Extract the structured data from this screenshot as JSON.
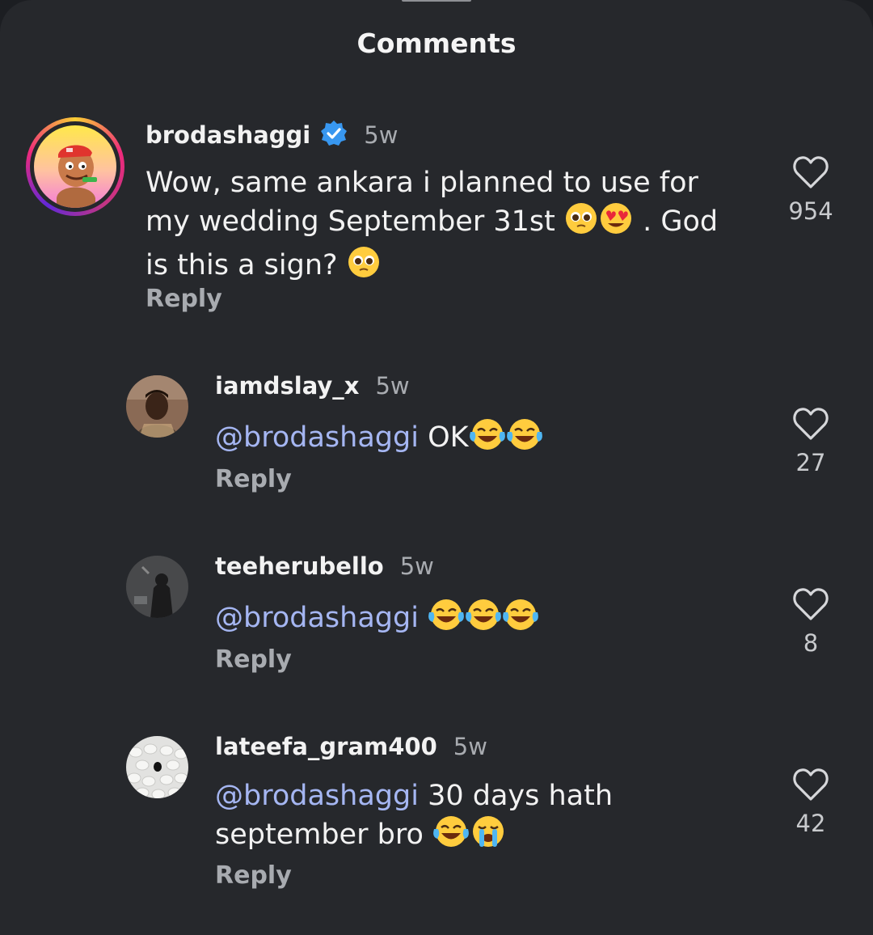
{
  "sheet": {
    "title": "Comments"
  },
  "comments": [
    {
      "username": "brodashaggi",
      "verified": true,
      "time": "5w",
      "text_parts": [
        "Wow, same ankara i planned to use for",
        "my wedding September 31st",
        ". God",
        "is this a sign?"
      ],
      "emojis": [
        "pleading-face",
        "pleading-face",
        "heart-eyes",
        "pleading-face"
      ],
      "reply_label": "Reply",
      "likes": "954"
    },
    {
      "username": "iamdslay_x",
      "time": "5w",
      "mention": "@brodashaggi",
      "text": "OK",
      "emojis": [
        "tears-of-joy",
        "tears-of-joy"
      ],
      "reply_label": "Reply",
      "likes": "27"
    },
    {
      "username": "teeherubello",
      "time": "5w",
      "mention": "@brodashaggi",
      "text": "",
      "emojis": [
        "tears-of-joy",
        "tears-of-joy",
        "tears-of-joy"
      ],
      "reply_label": "Reply",
      "likes": "8"
    },
    {
      "username": "lateefa_gram400",
      "time": "5w",
      "mention": "@brodashaggi",
      "text_parts": [
        "30 days hath",
        "september bro"
      ],
      "emojis": [
        "tears-of-joy",
        "loudly-crying"
      ],
      "reply_label": "Reply",
      "likes": "42"
    }
  ],
  "colors": {
    "sheet_background": "#26282c",
    "mention": "#a5b6f2",
    "verified_badge": "#3897f0"
  }
}
